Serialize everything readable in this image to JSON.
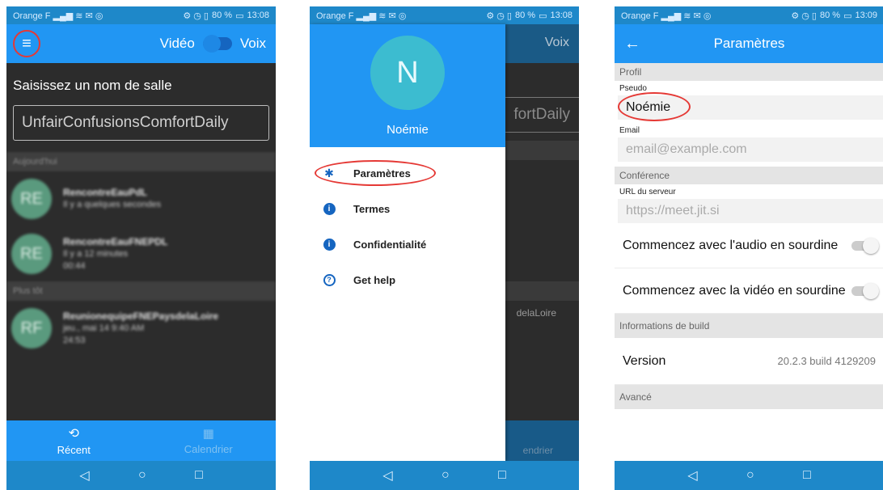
{
  "status": {
    "carrier": "Orange F",
    "battery": "80 %",
    "time_1": "13:08",
    "time_2": "13:08",
    "time_3": "13:09"
  },
  "screen1": {
    "video_label": "Vidéo",
    "voice_label": "Voix",
    "room_prompt": "Saisissez un nom de salle",
    "room_input_value": "UnfairConfusionsComfortDaily",
    "section_today": "Aujourd'hui",
    "section_older": "Plus tôt",
    "meetings": [
      {
        "initials": "RE",
        "name": "RencontreEauPdL",
        "line2": "Il y a quelques secondes",
        "line3": ""
      },
      {
        "initials": "RE",
        "name": "RencontreEauFNEPDL",
        "line2": "Il y a 12 minutes",
        "line3": "00:44"
      },
      {
        "initials": "RF",
        "name": "ReunionequipeFNEPaysdelaLoire",
        "line2": "jeu., mai 14 9:40 AM",
        "line3": "24:53"
      }
    ],
    "tabs": {
      "recent": "Récent",
      "calendar": "Calendrier"
    }
  },
  "screen2": {
    "avatar_initial": "N",
    "user_name": "Noémie",
    "bg_voice": "Voix",
    "bg_room_fragment": "fortDaily",
    "bg_meeting_fragment": "delaLoire",
    "bg_tab_fragment": "endrier",
    "menu": [
      {
        "label": "Paramètres",
        "icon": "gear-icon"
      },
      {
        "label": "Termes",
        "icon": "info-icon"
      },
      {
        "label": "Confidentialité",
        "icon": "info-icon"
      },
      {
        "label": "Get help",
        "icon": "help-icon"
      }
    ]
  },
  "screen3": {
    "title": "Paramètres",
    "section_profile": "Profil",
    "pseudo_label": "Pseudo",
    "pseudo_value": "Noémie",
    "email_label": "Email",
    "email_placeholder": "email@example.com",
    "section_conference": "Conférence",
    "server_label": "URL du serveur",
    "server_placeholder": "https://meet.jit.si",
    "audio_muted_label": "Commencez avec l'audio en sourdine",
    "video_muted_label": "Commencez avec la vidéo en sourdine",
    "section_build": "Informations de build",
    "version_label": "Version",
    "version_value": "20.2.3 build 4129209",
    "section_advanced": "Avancé"
  },
  "colors": {
    "primary": "#2196f3",
    "primary_dark": "#1e88c9",
    "highlight_red": "#e53935",
    "avatar_teal": "#3cbcd0",
    "meeting_avatar_green": "#5a9a7e"
  }
}
